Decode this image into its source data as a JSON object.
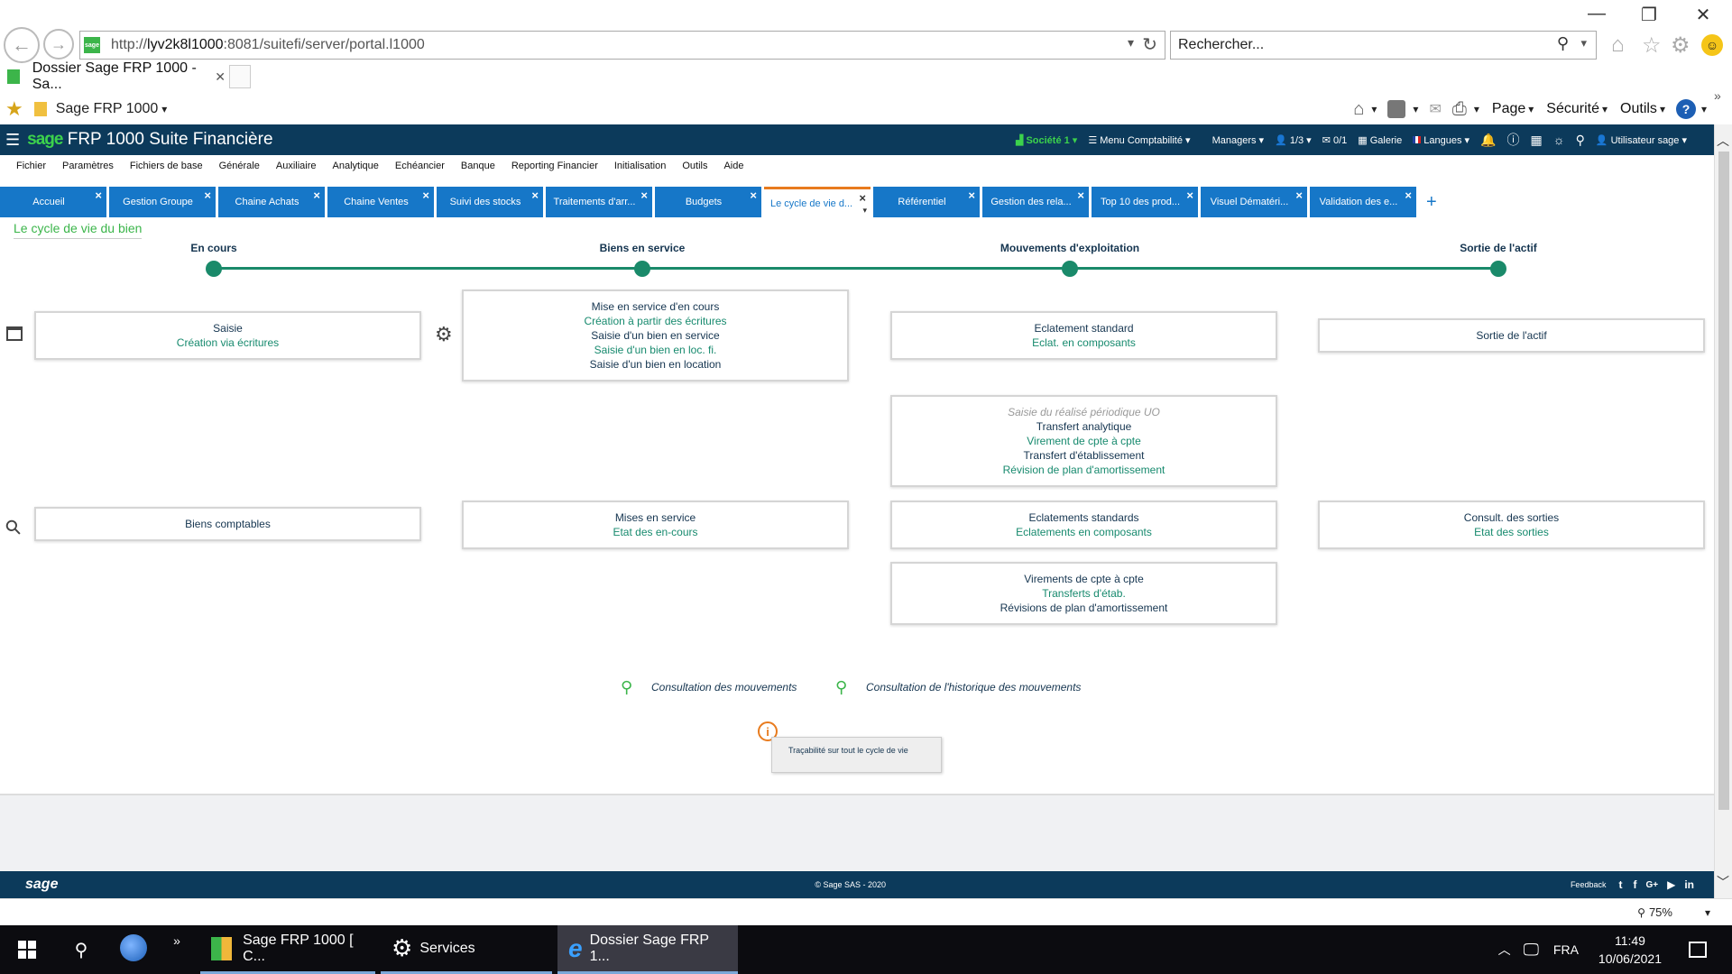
{
  "browser": {
    "url_prefix": "http://",
    "url_host": "lyv2k8l1000",
    "url_rest": ":8081/suitefi/server/portal.l1000",
    "search_placeholder": "Rechercher...",
    "tab_title": "Dossier Sage FRP 1000 - Sa...",
    "favorite_label": "Sage FRP 1000",
    "commands": [
      "Page",
      "Sécurité",
      "Outils"
    ],
    "zoom": "75%"
  },
  "app": {
    "logo_sage": "sage",
    "logo_rest": "FRP 1000 Suite Financière",
    "header_items": [
      "Société 1 ▾",
      "Menu Comptabilité ▾",
      "Managers ▾",
      "1/3 ▾",
      "0/1",
      "Galerie",
      "Langues ▾",
      "Utilisateur sage ▾"
    ],
    "menu": [
      "Fichier",
      "Paramètres",
      "Fichiers de base",
      "Générale",
      "Auxiliaire",
      "Analytique",
      "Echéancier",
      "Banque",
      "Reporting Financier",
      "Initialisation",
      "Outils",
      "Aide"
    ],
    "tabs": [
      "Accueil",
      "Gestion Groupe",
      "Chaine Achats",
      "Chaine Ventes",
      "Suivi des stocks",
      "Traitements d'arr...",
      "Budgets",
      "Le cycle de vie d...",
      "Référentiel",
      "Gestion des rela...",
      "Top 10 des prod...",
      "Visuel Dématéri...",
      "Validation des e..."
    ],
    "active_tab": "Le cycle de vie d..."
  },
  "page": {
    "title": "Le cycle de vie du bien",
    "stages": [
      "En cours",
      "Biens en service",
      "Mouvements d'exploitation",
      "Sortie de l'actif"
    ],
    "card_saisie": {
      "l1": "Saisie",
      "l2": "Création via écritures"
    },
    "card_mise_service": {
      "l1": "Mise en service d'en cours",
      "l2": "Création à partir des écritures",
      "l3": "Saisie d'un bien en service",
      "l4": "Saisie d'un bien en loc. fi.",
      "l5": "Saisie d'un bien en location"
    },
    "card_eclatement": {
      "l1": "Eclatement standard",
      "l2": "Eclat. en composants"
    },
    "card_sortie": {
      "l1": "Sortie de l'actif"
    },
    "card_mouvements": {
      "l1": "Saisie du réalisé périodique UO",
      "l2": "Transfert analytique",
      "l3": "Virement de cpte à cpte",
      "l4": "Transfert d'établissement",
      "l5": "Révision de plan d'amortissement"
    },
    "card_biens_comptables": {
      "l1": "Biens comptables"
    },
    "card_mises_service": {
      "l1": "Mises en service",
      "l2": "Etat des en-cours"
    },
    "card_eclatements": {
      "l1": "Eclatements standards",
      "l2": "Eclatements en composants"
    },
    "card_consult_sorties": {
      "l1": "Consult. des sorties",
      "l2": "Etat des sorties"
    },
    "card_virements": {
      "l1": "Virements de cpte à cpte",
      "l2": "Transferts d'étab.",
      "l3": "Révisions de plan d'amortissement"
    },
    "consult_mouvements": "Consultation des mouvements",
    "consult_historique": "Consultation de l'historique des mouvements",
    "tooltip": "Traçabilité sur tout le cycle de vie"
  },
  "footer": {
    "logo": "sage",
    "copyright": "© Sage SAS - 2020",
    "feedback": "Feedback"
  },
  "taskbar": {
    "apps": [
      "Sage FRP 1000 [ C...",
      "Services",
      "Dossier Sage FRP 1..."
    ],
    "lang": "FRA",
    "time": "11:49",
    "date": "10/06/2021"
  }
}
